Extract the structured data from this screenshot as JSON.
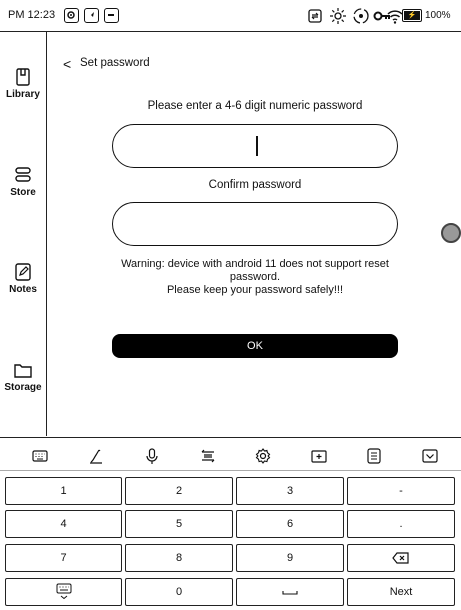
{
  "status_bar": {
    "time": "PM 12:23",
    "battery_percent": "100%",
    "left_icons": [
      "circle-dot-icon",
      "send-icon",
      "minus-box-icon"
    ],
    "right_icons": [
      "screen-refresh-icon",
      "brightness-icon",
      "sync-icon",
      "key-icon",
      "wifi-icon",
      "battery-icon"
    ]
  },
  "sidebar": {
    "items": [
      {
        "label": "Library",
        "icon": "library-icon"
      },
      {
        "label": "Store",
        "icon": "store-icon"
      },
      {
        "label": "Notes",
        "icon": "notes-icon"
      },
      {
        "label": "Storage",
        "icon": "storage-icon"
      }
    ]
  },
  "header": {
    "back_glyph": "<",
    "title": "Set password"
  },
  "form": {
    "prompt": "Please enter a 4-6 digit numeric password",
    "password_value": "",
    "confirm_label": "Confirm password",
    "confirm_value": "",
    "warning_line1": "Warning: device with android 11 does not support reset",
    "warning_line2": "password.",
    "warning_line3": "Please keep your password safely!!!",
    "ok_label": "OK"
  },
  "keyboard": {
    "toolbar_icons": [
      "keyboard-icon",
      "handwriting-icon",
      "microphone-icon",
      "clipboard-swap-icon",
      "settings-gear-icon",
      "window-add-icon",
      "notepad-icon",
      "hide-keyboard-icon"
    ],
    "rows": [
      [
        "1",
        "2",
        "3",
        "-"
      ],
      [
        "4",
        "5",
        "6",
        "."
      ],
      [
        "7",
        "8",
        "9",
        "backspace"
      ],
      [
        "keyboard-switch",
        "0",
        "space",
        "Next"
      ]
    ],
    "labels": {
      "k1": "1",
      "k2": "2",
      "k3": "3",
      "kminus": "-",
      "k4": "4",
      "k5": "5",
      "k6": "6",
      "kdot": ".",
      "k7": "7",
      "k8": "8",
      "k9": "9",
      "k0": "0",
      "next": "Next"
    }
  }
}
